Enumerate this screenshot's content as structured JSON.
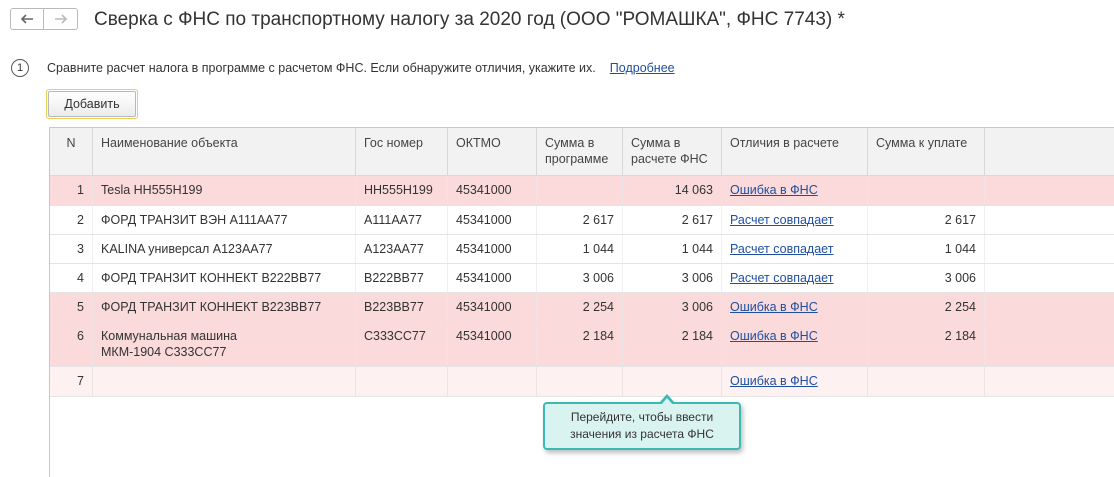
{
  "window": {
    "title": "Сверка с ФНС по транспортному налогу за 2020 год (ООО \"РОМАШКА\", ФНС 7743) *"
  },
  "nav": {
    "back_icon": "arrow-left-icon",
    "forward_icon": "arrow-right-icon"
  },
  "step": {
    "number": "1",
    "text": "Сравните расчет налога в программе с расчетом ФНС. Если обнаружите отличия, укажите их.",
    "link": "Подробнее"
  },
  "toolbar": {
    "add_label": "Добавить"
  },
  "table": {
    "headers": {
      "n": "N",
      "name": "Наименование объекта",
      "plate": "Гос номер",
      "oktmo": "ОКТМО",
      "sum_program": "Сумма в программе",
      "sum_fns": "Сумма в расчете ФНС",
      "diff": "Отличия в расчете",
      "sum_pay": "Сумма к уплате"
    },
    "rows": [
      {
        "n": "1",
        "name": "Tesla НН555Н199",
        "plate": "НН555Н199",
        "oktmo": "45341000",
        "sum_program": "",
        "sum_fns": "14 063",
        "diff": "Ошибка в ФНС",
        "sum_pay": "",
        "status": "error"
      },
      {
        "n": "2",
        "name": "ФОРД ТРАНЗИТ ВЭН А111АА77",
        "plate": "А111АА77",
        "oktmo": "45341000",
        "sum_program": "2 617",
        "sum_fns": "2 617",
        "diff": "Расчет совпадает",
        "sum_pay": "2 617",
        "status": "ok"
      },
      {
        "n": "3",
        "name": "KALINA универсал А123АА77",
        "plate": "А123АА77",
        "oktmo": "45341000",
        "sum_program": "1 044",
        "sum_fns": "1 044",
        "diff": "Расчет совпадает",
        "sum_pay": "1 044",
        "status": "ok"
      },
      {
        "n": "4",
        "name": "ФОРД ТРАНЗИТ КОННЕКТ В222ВВ77",
        "plate": "В222ВВ77",
        "oktmo": "45341000",
        "sum_program": "3 006",
        "sum_fns": "3 006",
        "diff": "Расчет совпадает",
        "sum_pay": "3 006",
        "status": "ok"
      },
      {
        "n": "5",
        "name": "ФОРД ТРАНЗИТ КОННЕКТ В223ВВ77",
        "plate": "В223ВВ77",
        "oktmo": "45341000",
        "sum_program": "2 254",
        "sum_fns": "3 006",
        "diff": "Ошибка в ФНС",
        "sum_pay": "2 254",
        "status": "error"
      },
      {
        "n": "6",
        "name": "Коммунальная машина МКМ-1904 С333СС77",
        "plate": "С333СС77",
        "oktmo": "45341000",
        "sum_program": "2 184",
        "sum_fns": "2 184",
        "diff": "Ошибка в ФНС",
        "sum_pay": "2 184",
        "status": "error"
      },
      {
        "n": "7",
        "name": "",
        "plate": "",
        "oktmo": "",
        "sum_program": "",
        "sum_fns": "",
        "diff": "Ошибка в ФНС",
        "sum_pay": "",
        "status": "empty"
      }
    ]
  },
  "tooltip": {
    "text": "Перейдите, чтобы ввести значения из расчета ФНС"
  },
  "colors": {
    "error_row": "#fadadb",
    "link": "#1f4fa0",
    "tooltip_border": "#3cb9b2",
    "tooltip_bg": "#d9f3f1"
  }
}
